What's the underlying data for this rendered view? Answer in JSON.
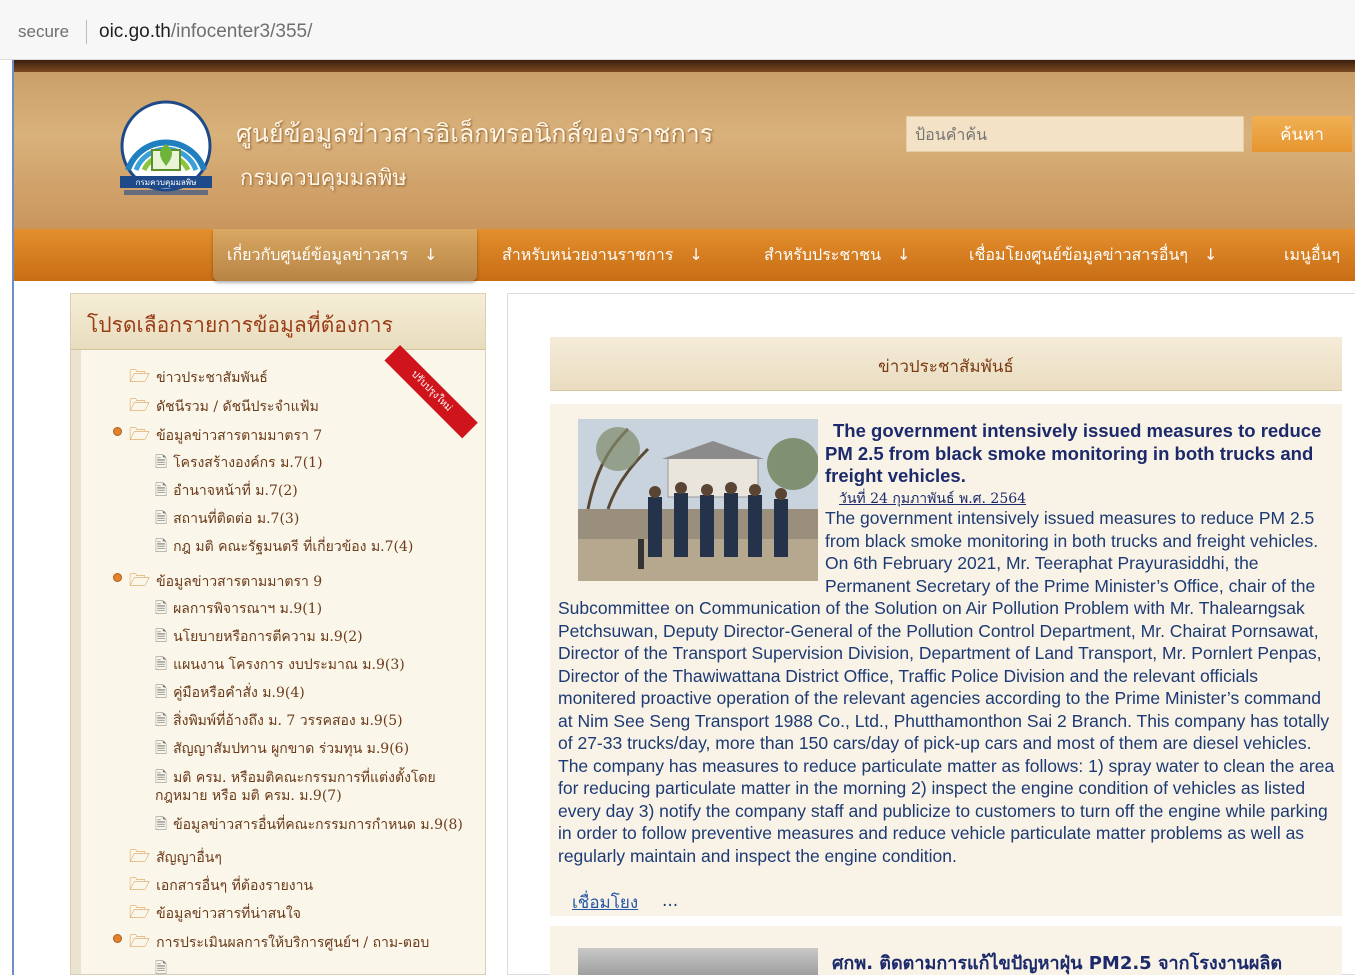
{
  "browser": {
    "security_label": "secure",
    "url_host": "oic.go.th",
    "url_path": "/infocenter3/355/"
  },
  "header": {
    "title_line1": "ศูนย์ข้อมูลข่าวสารอิเล็กทรอนิกส์ของราชการ",
    "title_line2": "กรมควบคุมมลพิษ",
    "search_placeholder": "ป้อนคำค้น",
    "search_button": "ค้นหา",
    "logo_text": "กรมควบคุมมลพิษ"
  },
  "nav": {
    "items": [
      {
        "label": "เกี่ยวกับศูนย์ข้อมูลข่าวสาร"
      },
      {
        "label": "สำหรับหน่วยงานราชการ"
      },
      {
        "label": "สำหรับประชาชน"
      },
      {
        "label": "เชื่อมโยงศูนย์ข้อมูลข่าวสารอื่นๆ"
      },
      {
        "label": "เมนูอื่นๆ"
      }
    ],
    "arrow": "↓"
  },
  "sidebar": {
    "title": "โปรดเลือกรายการข้อมูลที่ต้องการ",
    "ribbon": "ปรับปรุงใหม่",
    "items": [
      {
        "label": "ข่าวประชาสัมพันธ์"
      },
      {
        "label": "ดัชนีรวม / ดัชนีประจำแฟ้ม"
      },
      {
        "label": "ข้อมูลข่าวสารตามมาตรา 7"
      },
      {
        "label": "โครงสร้างองค์กร ม.7(1)"
      },
      {
        "label": "อำนาจหน้าที่ ม.7(2)"
      },
      {
        "label": "สถานที่ติดต่อ ม.7(3)"
      },
      {
        "label": "กฎ มติ คณะรัฐมนตรี ที่เกี่ยวข้อง ม.7(4)"
      },
      {
        "label": "ข้อมูลข่าวสารตามมาตรา 9"
      },
      {
        "label": "ผลการพิจารณาฯ ม.9(1)"
      },
      {
        "label": "นโยบายหรือการตีความ ม.9(2)"
      },
      {
        "label": "แผนงาน โครงการ งบประมาณ ม.9(3)"
      },
      {
        "label": "คู่มือหรือคำสั่ง ม.9(4)"
      },
      {
        "label": "สิ่งพิมพ์ที่อ้างถึง ม. 7 วรรคสอง ม.9(5)"
      },
      {
        "label": "สัญญาสัมปทาน ผูกขาด ร่วมทุน ม.9(6)"
      },
      {
        "label": "มติ ครม. หรือมติคณะกรรมการที่แต่งตั้งโดยกฎหมาย หรือ มติ ครม. ม.9(7)"
      },
      {
        "label": "ข้อมูลข่าวสารอื่นที่คณะกรรมการกำหนด ม.9(8)"
      },
      {
        "label": "สัญญาอื่นๆ"
      },
      {
        "label": "เอกสารอื่นๆ ที่ต้องรายงาน"
      },
      {
        "label": "ข้อมูลข่าวสารที่น่าสนใจ"
      },
      {
        "label": "การประเมินผลการให้บริการศูนย์ฯ / ถาม-ตอบ"
      }
    ]
  },
  "main": {
    "section_title": "ข่าวประชาสัมพันธ์",
    "news": [
      {
        "title": "The government intensively issued measures to reduce PM 2.5 from black smoke monitoring in both trucks and freight vehicles.",
        "date": "วันที่ 24 กุมภาพันธ์ พ.ศ. 2564",
        "body": "The government intensively issued measures to reduce PM 2.5 from black smoke monitoring in both trucks and freight vehicles. On 6th February 2021, Mr. Teeraphat Prayurasiddhi, the Permanent Secretary of the Prime Minister’s Office, chair of the Subcommittee on Communication of the Solution on Air Pollution Problem with Mr. Thalearngsak Petchsuwan, Deputy Director-General of the Pollution Control Department, Mr. Chairat Pornsawat, Director of the Transport Supervision Division, Department of Land Transport, Mr. Pornlert Penpas, Director of the Thawiwattana District Office, Traffic Police Division and the relevant officials monitered proactive operation of the relevant agencies according to the Prime Minister’s command at Nim See Seng Transport 1988 Co., Ltd., Phutthamonthon Sai 2 Branch. This company has totally of 27-33 trucks/day, more than 150 cars/day of pick-up cars and most of them are diesel vehicles. The company has measures to reduce particulate matter as follows: 1) spray water to clean the area for reducing particulate matter in the morning 2) inspect the engine condition of vehicles as listed every day 3) notify the company staff and publicize to customers to turn off the engine while parking in order to follow preventive measures and reduce vehicle particulate matter problems as well as regularly maintain and inspect the engine condition.",
        "link": "เชื่อมโยง",
        "more": "..."
      },
      {
        "title": "ศกพ. ติดตามการแก้ไขปัญหาฝุ่น PM2.5 จากโรงงานผลิต"
      }
    ]
  },
  "colors": {
    "header_bg": "#d9b17b",
    "nav_bg": "#d67e20",
    "sidebar_title": "#9a3c15",
    "news_title": "#1c2a6b",
    "news_body": "#1d3a74",
    "link": "#2457a6"
  },
  "icons": {
    "folder": "folder-icon",
    "document": "document-icon",
    "bullet": "orange-bullet-icon"
  }
}
